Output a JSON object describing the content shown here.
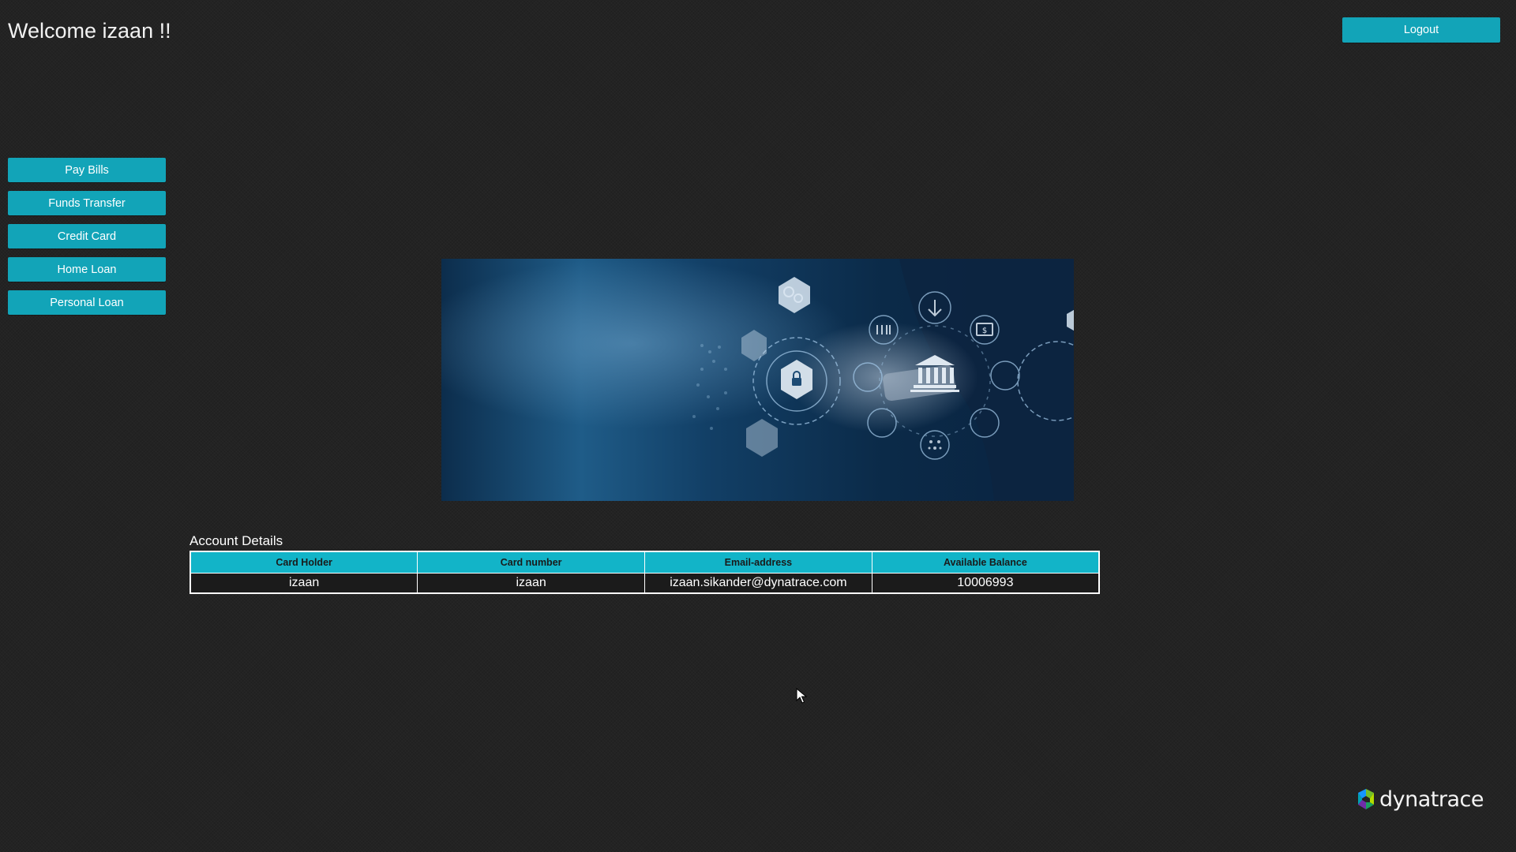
{
  "header": {
    "welcome_text": "Welcome izaan !!",
    "logout_label": "Logout"
  },
  "sidebar": {
    "items": [
      {
        "label": "Pay Bills"
      },
      {
        "label": "Funds Transfer"
      },
      {
        "label": "Credit Card"
      },
      {
        "label": "Home Loan"
      },
      {
        "label": "Personal Loan"
      }
    ]
  },
  "account": {
    "title": "Account Details",
    "columns": [
      "Card Holder",
      "Card number",
      "Email-address",
      "Available Balance"
    ],
    "rows": [
      [
        "izaan",
        "izaan",
        "izaan.sikander@dynatrace.com",
        "10006993"
      ]
    ]
  },
  "footer": {
    "brand_name": "dynatrace"
  },
  "colors": {
    "accent": "#12a4b8",
    "background": "#232323"
  }
}
